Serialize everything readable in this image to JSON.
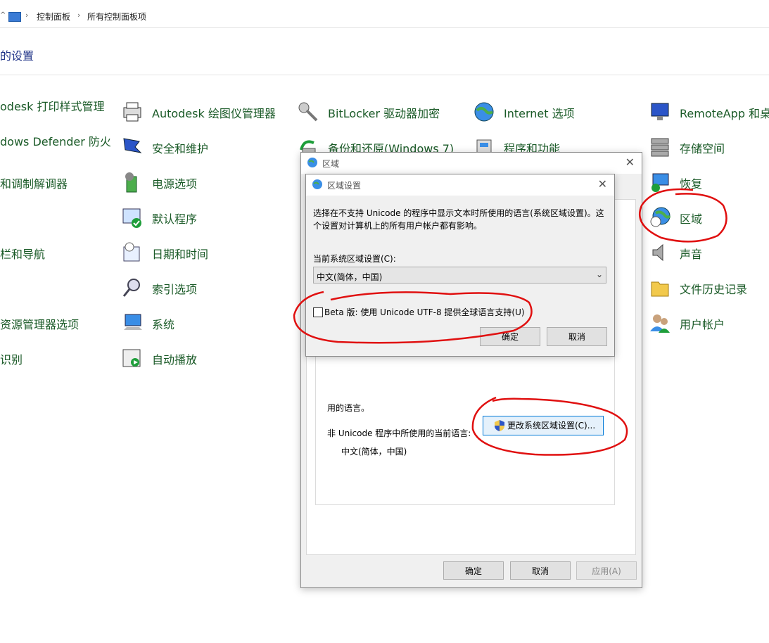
{
  "address": {
    "crumb1": "控制面板",
    "crumb2": "所有控制面板项"
  },
  "subtitle": "的设置",
  "panel": {
    "col0": [
      "odesk 打印样式管理",
      "dows Defender 防火",
      "和调制解调器",
      "栏和导航",
      "资源管理器选项",
      "识别"
    ],
    "col1": [
      "Autodesk 绘图仪管理器",
      "安全和维护",
      "电源选项",
      "默认程序",
      "日期和时间",
      "索引选项",
      "系统",
      "自动播放"
    ],
    "col2": [
      "BitLocker 驱动器加密",
      "备份和还原(Windows 7)"
    ],
    "col3": [
      "Internet 选项",
      "程序和功能"
    ],
    "col4": [
      "RemoteApp 和桌",
      "存储空间",
      "恢复",
      "区域",
      "声音",
      "文件历史记录",
      "用户帐户"
    ]
  },
  "region_dialog": {
    "title": "区域",
    "partial_text": "用的语言。",
    "current_lang_label": "非 Unicode 程序中所使用的当前语言:",
    "current_lang_value": "中文(简体，中国)",
    "change_button": "更改系统区域设置(C)...",
    "ok": "确定",
    "cancel": "取消",
    "apply": "应用(A)"
  },
  "locale_dialog": {
    "title": "区域设置",
    "description_line1": "选择在不支持 Unicode 的程序中显示文本时所使用的语言(系统区域设置)。这",
    "description_line2": "个设置对计算机上的所有用户帐户都有影响。",
    "current_label": "当前系统区域设置(C):",
    "current_value": "中文(简体，中国)",
    "beta_label": "Beta 版: 使用 Unicode UTF-8 提供全球语言支持(U)",
    "ok": "确定",
    "cancel": "取消"
  },
  "colors": {
    "link_green": "#1a5a27",
    "annotation_red": "#e01010",
    "accent_blue": "#0078d7"
  }
}
